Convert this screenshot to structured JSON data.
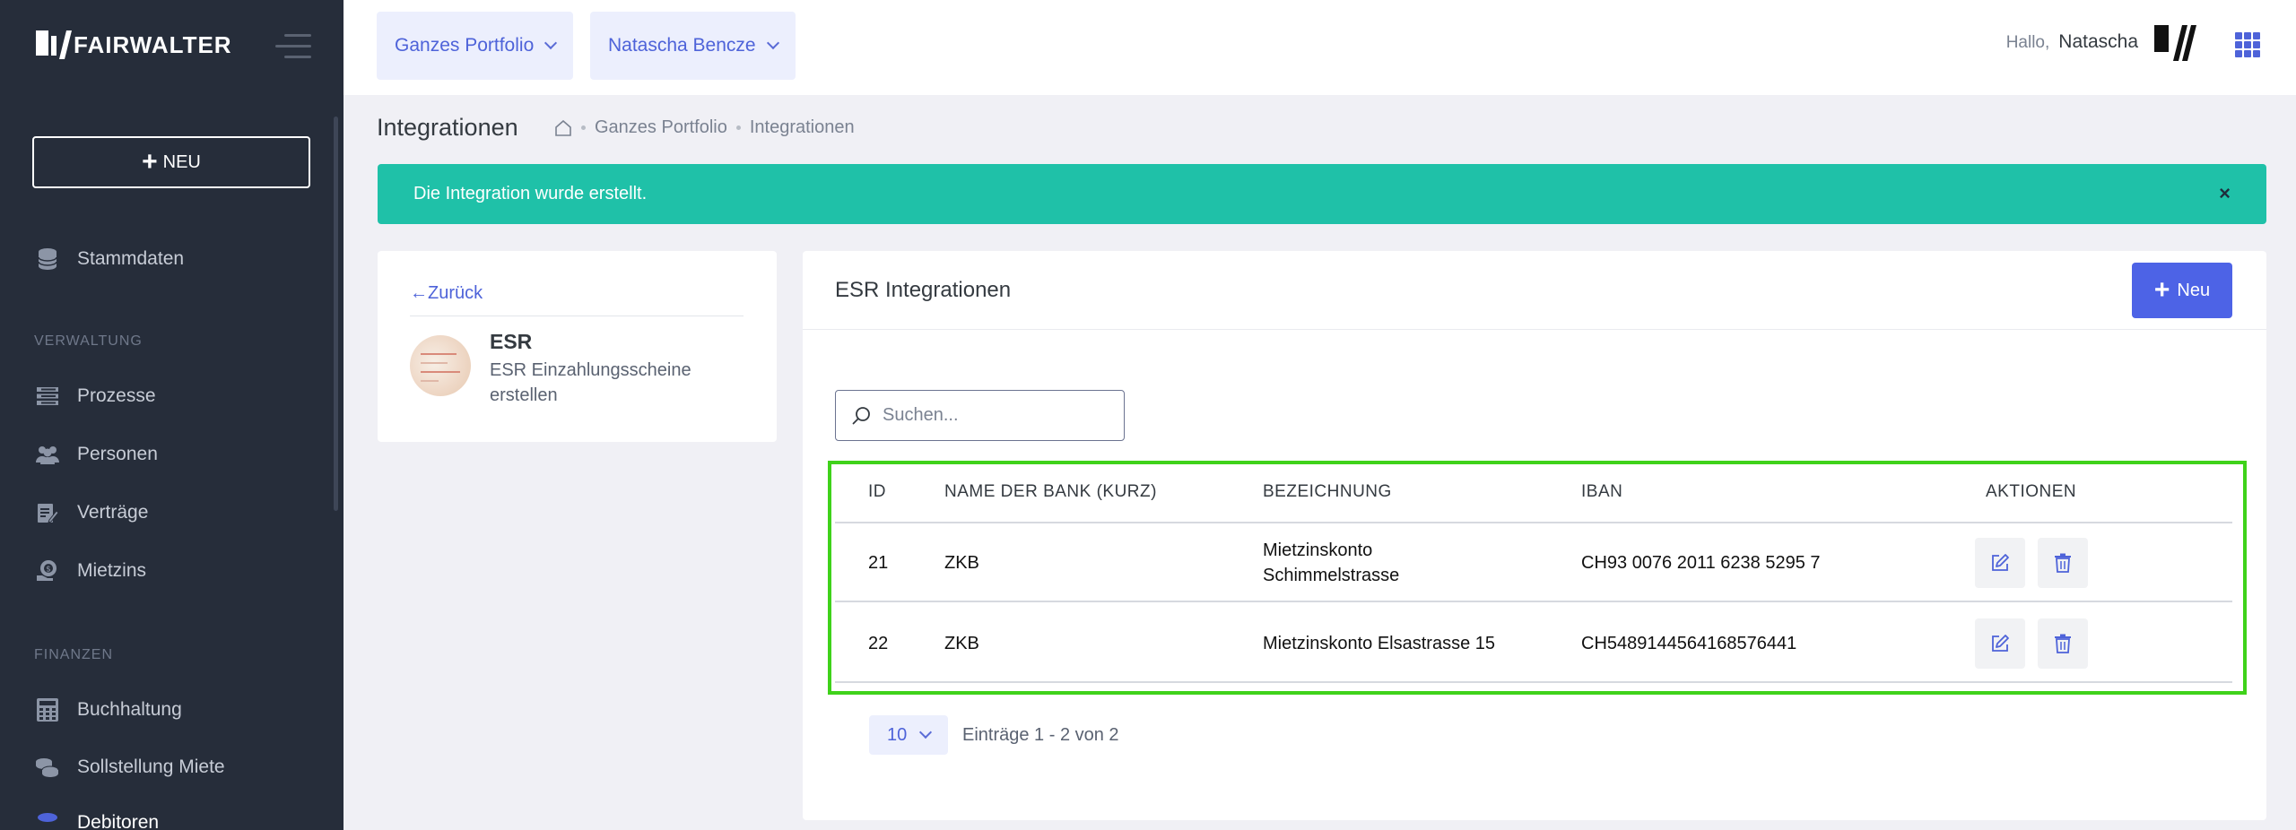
{
  "app": {
    "logo_text": "FAIRWALTER"
  },
  "sidebar": {
    "new_button_label": "NEU",
    "items": [
      {
        "label": "Stammdaten",
        "icon": "database-icon"
      },
      {
        "label": "Prozesse",
        "icon": "list-icon"
      },
      {
        "label": "Personen",
        "icon": "people-icon"
      },
      {
        "label": "Verträge",
        "icon": "contract-icon"
      },
      {
        "label": "Mietzins",
        "icon": "hand-coin-icon"
      },
      {
        "label": "Buchhaltung",
        "icon": "calculator-icon"
      },
      {
        "label": "Sollstellung Miete",
        "icon": "coins-icon"
      },
      {
        "label": "Debitoren",
        "icon": "coins-stack-icon"
      }
    ],
    "sections": {
      "verwaltung": "VERWALTUNG",
      "finanzen": "FINANZEN"
    }
  },
  "topbar": {
    "portfolio_dropdown": "Ganzes Portfolio",
    "user_dropdown": "Natascha Bencze",
    "greeting_prefix": "Hallo,",
    "greeting_name": "Natascha"
  },
  "page": {
    "title": "Integrationen",
    "breadcrumb": [
      "Ganzes Portfolio",
      "Integrationen"
    ]
  },
  "alert": {
    "message": "Die Integration wurde erstellt.",
    "close": "×",
    "color": "#1fc1a8"
  },
  "left_card": {
    "back_label": "←Zurück",
    "integration_title": "ESR",
    "integration_desc": "ESR Einzahlungsscheine erstellen"
  },
  "right_card": {
    "title": "ESR Integrationen",
    "new_button_label": "Neu",
    "search_placeholder": "Suchen...",
    "table": {
      "headers": [
        "ID",
        "NAME DER BANK (KURZ)",
        "BEZEICHNUNG",
        "IBAN",
        "AKTIONEN"
      ],
      "rows": [
        {
          "id": "21",
          "bank": "ZKB",
          "bezeichnung_l1": "Mietzinskonto",
          "bezeichnung_l2": "Schimmelstrasse",
          "iban": "CH93 0076 2011 6238 5295 7"
        },
        {
          "id": "22",
          "bank": "ZKB",
          "bezeichnung_l1": "Mietzinskonto Elsastrasse 15",
          "bezeichnung_l2": "",
          "iban": "CH5489144564168576441"
        }
      ]
    },
    "pagination": {
      "page_size": "10",
      "info": "Einträge 1 - 2 von 2"
    }
  },
  "colors": {
    "accent": "#4d63e6",
    "sidebar_bg": "#262d3a",
    "highlight": "#3fd21a"
  }
}
